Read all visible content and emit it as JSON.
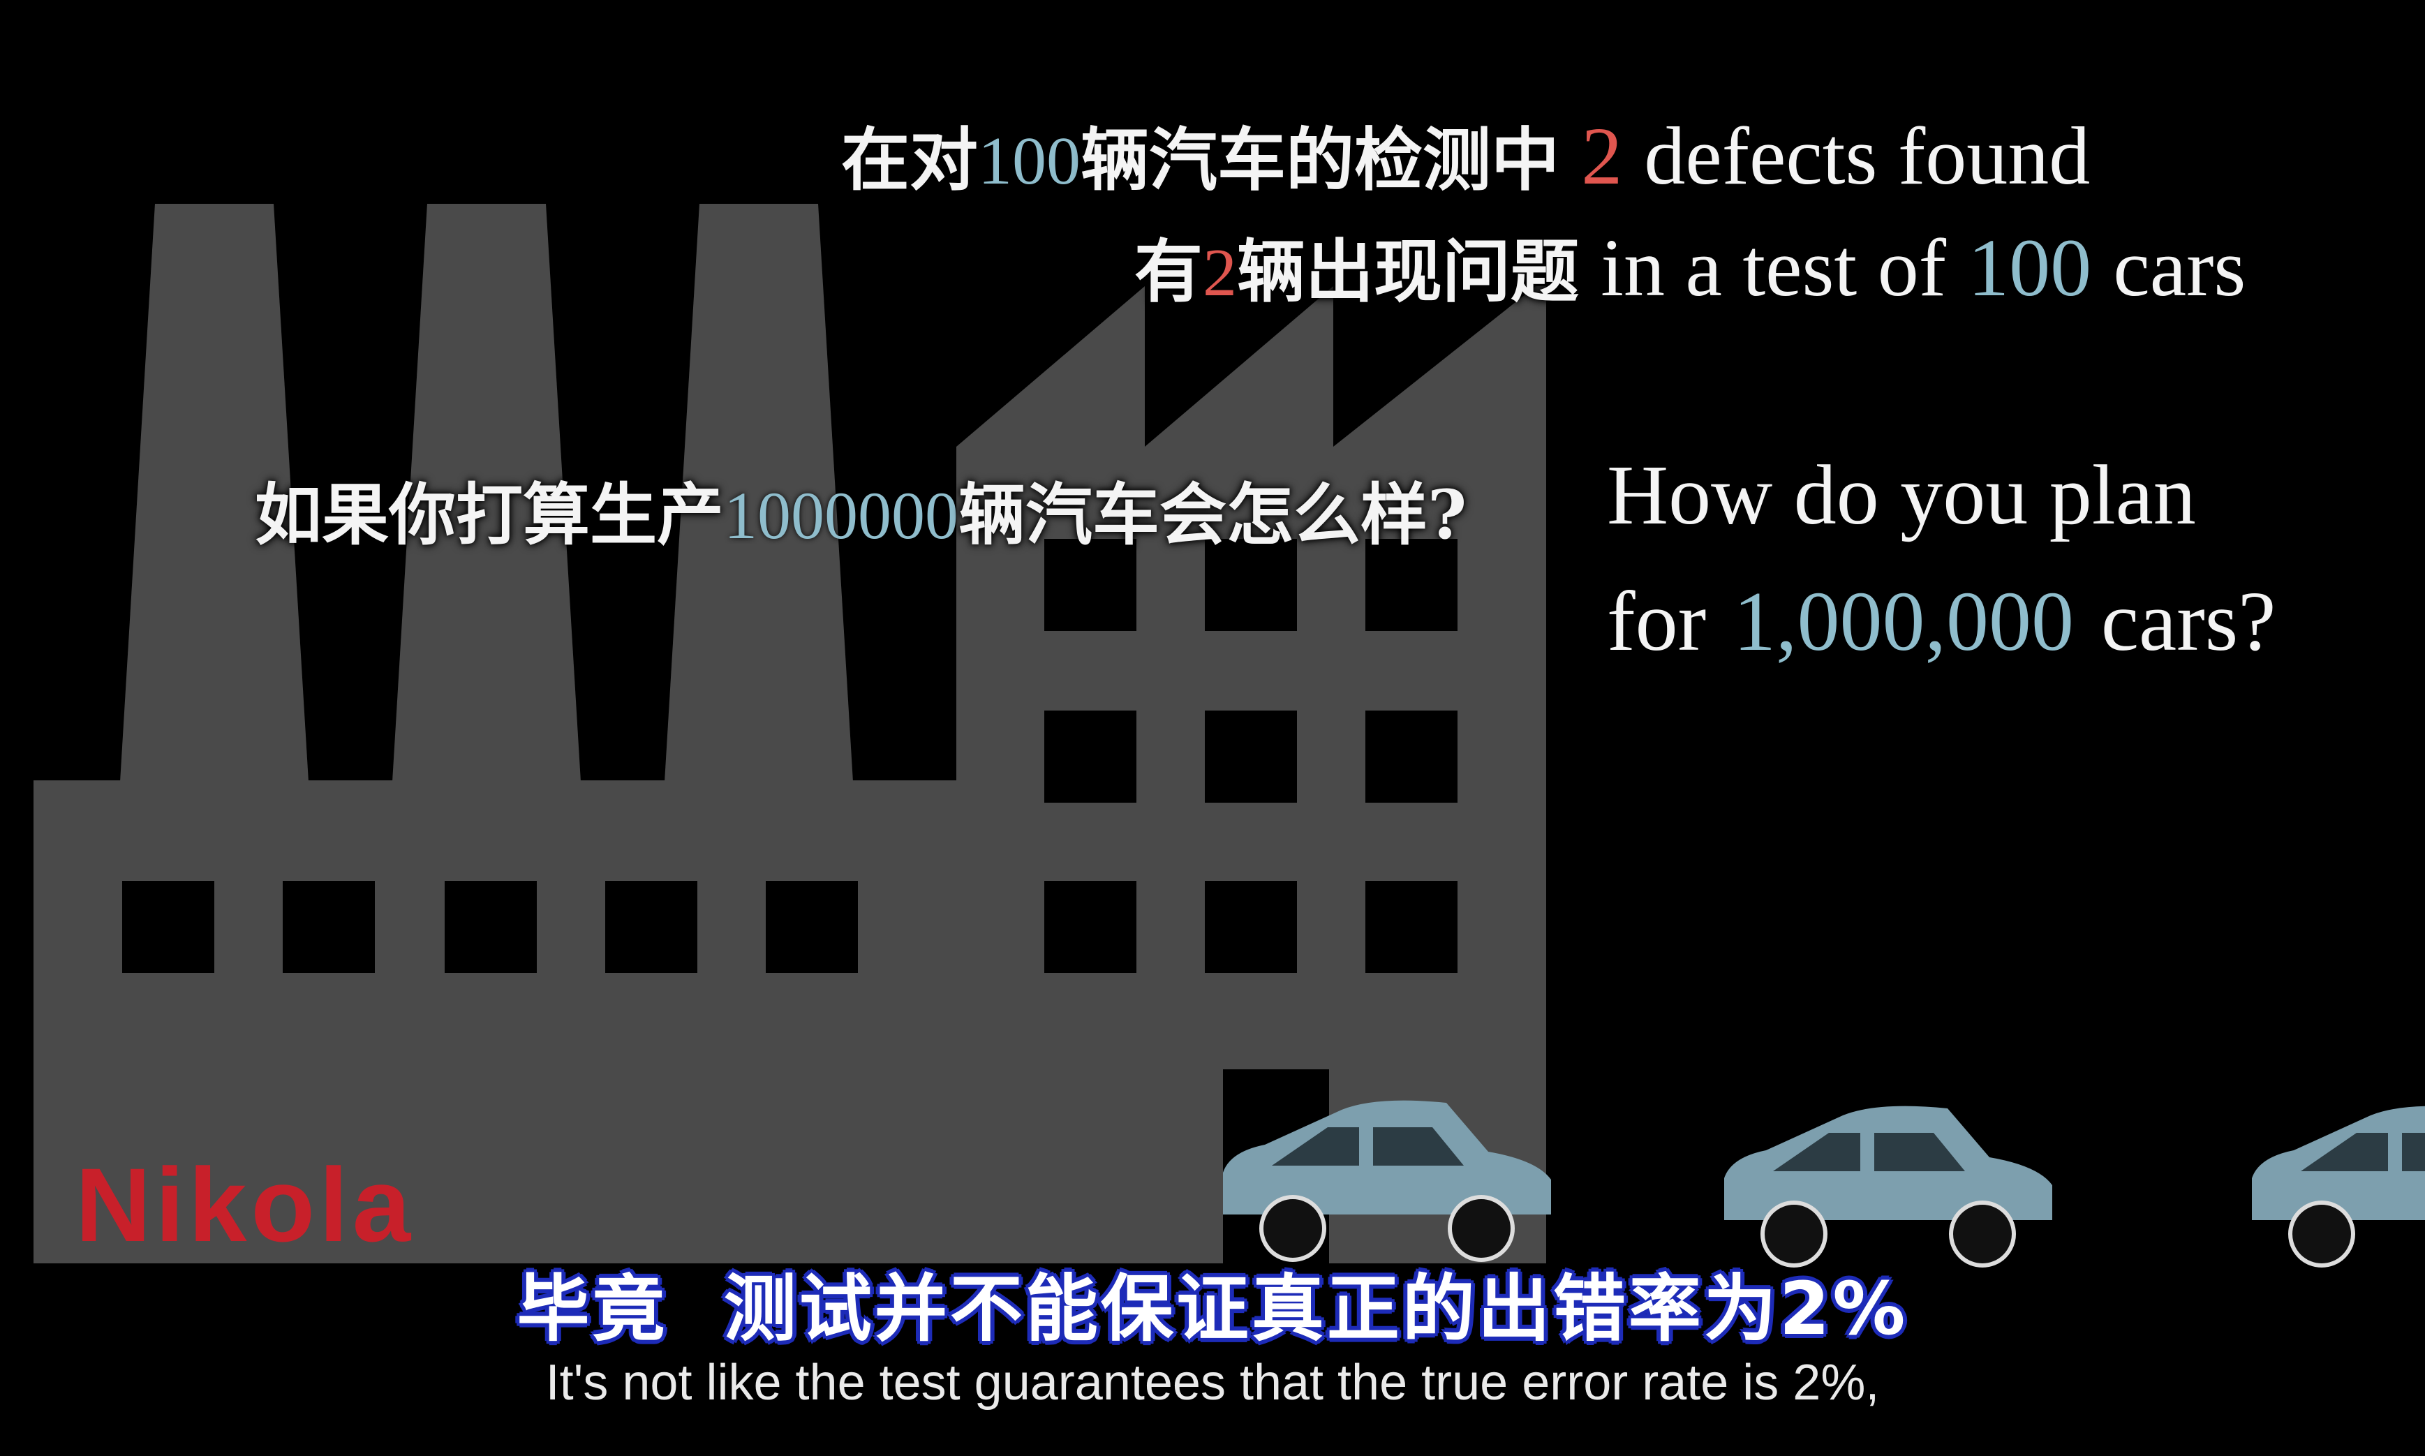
{
  "headline": {
    "zh_1_prefix": "在对",
    "zh_1_number": "100",
    "zh_1_suffix": "辆汽车的检测中",
    "en_1_number": "2",
    "en_1_text": "defects found",
    "zh_2_prefix": "有",
    "zh_2_number": "2",
    "zh_2_suffix": "辆出现问题",
    "en_2_prefix": "in a test of",
    "en_2_number": "100",
    "en_2_suffix": "cars"
  },
  "question": {
    "zh_prefix": "如果你打算生产",
    "zh_number": "1000000",
    "zh_suffix": "辆汽车会怎么样?",
    "en_line1": "How do you plan",
    "en_line2_prefix": "for",
    "en_line2_number": "1,000,000",
    "en_line2_suffix": "cars?"
  },
  "logo": {
    "text": "Nikola"
  },
  "subtitles": {
    "zh": "毕竟  测试并不能保证真正的出错率为2%",
    "en": "It's not like the test guarantees that the true error rate is 2%,"
  },
  "colors": {
    "factory": "#4a4a4a",
    "car": "#7d9fae",
    "highlight_blue": "#8fbdcc",
    "highlight_red": "#e0564f",
    "logo": "#c8202a"
  }
}
